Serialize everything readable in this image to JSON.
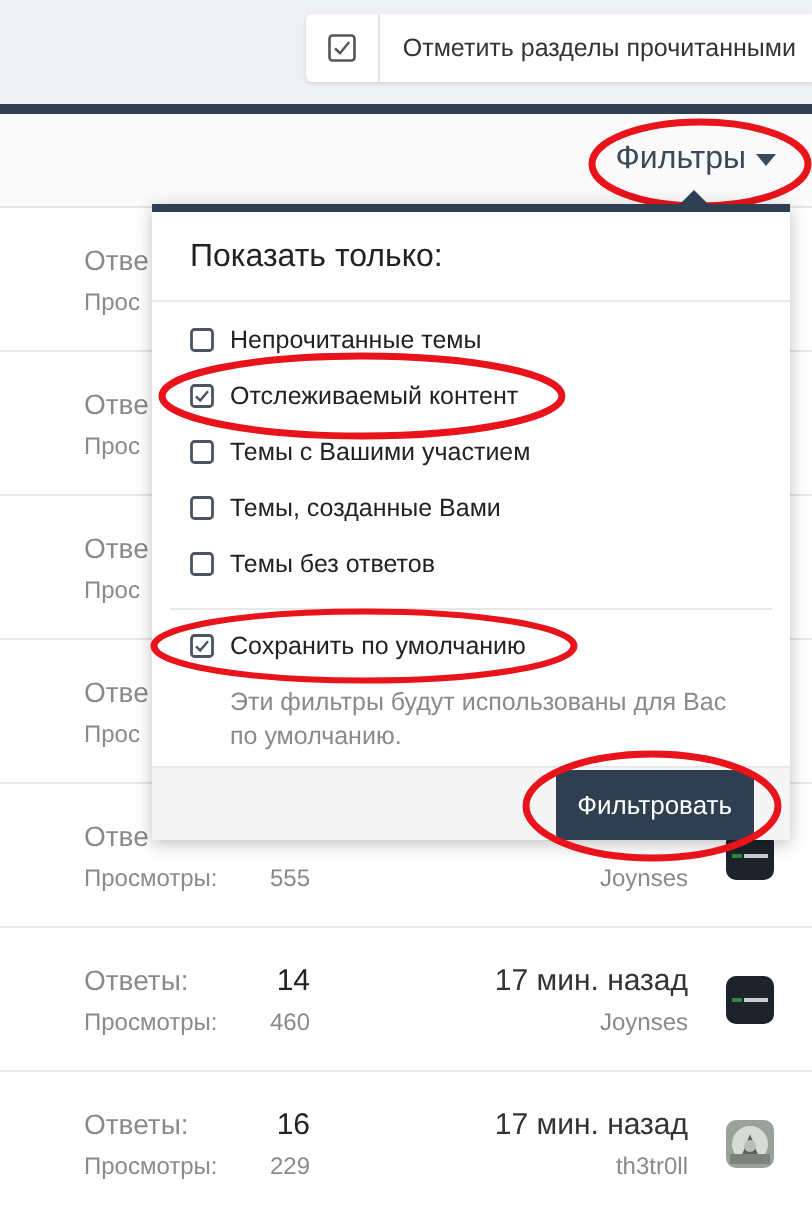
{
  "mark_read_button": {
    "label": "Отметить разделы прочитанными",
    "checked": true
  },
  "filter_bar": {
    "label": "Фильтры",
    "highlighted": true
  },
  "threads": [
    {
      "replies_label": "Отве",
      "views_label": "Прос"
    },
    {
      "replies_label": "Отве",
      "views_label": "Прос"
    },
    {
      "replies_label": "Отве",
      "views_label": "Прос"
    },
    {
      "replies_label": "Отве",
      "views_label": "Прос"
    },
    {
      "replies_label": "Отве",
      "views_label": "Просмотры:",
      "views": "555",
      "user": "Joynses"
    },
    {
      "replies_label": "Ответы:",
      "replies": "14",
      "views_label": "Просмотры:",
      "views": "460",
      "time": "17 мин. назад",
      "user": "Joynses"
    },
    {
      "replies_label": "Ответы:",
      "replies": "16",
      "views_label": "Просмотры:",
      "views": "229",
      "time": "17 мин. назад",
      "user": "th3tr0ll"
    }
  ],
  "filter_menu": {
    "title": "Показать только:",
    "options": [
      {
        "label": "Непрочитанные темы",
        "checked": false,
        "highlighted": false
      },
      {
        "label": "Отслеживаемый контент",
        "checked": true,
        "highlighted": true
      },
      {
        "label": "Темы с Вашими участием",
        "checked": false,
        "highlighted": false
      },
      {
        "label": "Темы, созданные Вами",
        "checked": false,
        "highlighted": false
      },
      {
        "label": "Темы без ответов",
        "checked": false,
        "highlighted": false
      }
    ],
    "save_default": {
      "label": "Сохранить по умолчанию",
      "checked": true,
      "highlighted": true,
      "hint": "Эти фильтры будут использованы для Вас по умолчанию."
    },
    "submit": {
      "label": "Фильтровать",
      "highlighted": true
    }
  }
}
